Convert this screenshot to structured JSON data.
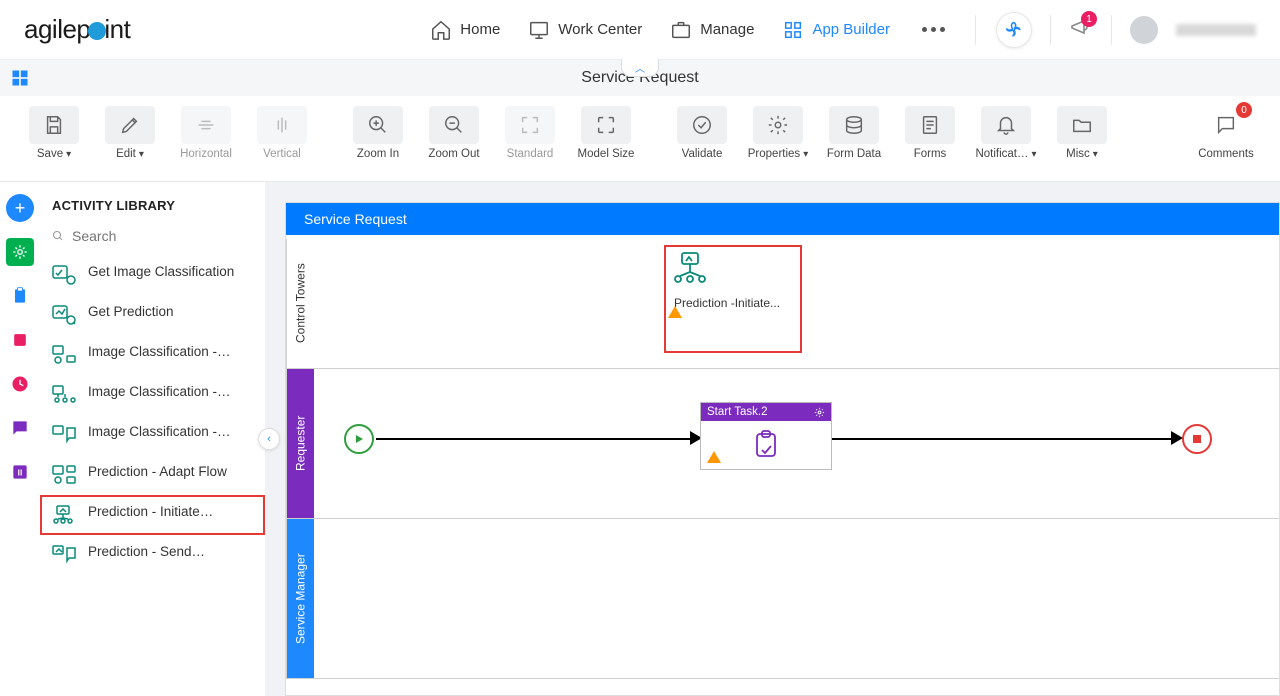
{
  "brand": {
    "name_a": "agilep",
    "name_b": "int"
  },
  "nav": {
    "home": "Home",
    "work_center": "Work Center",
    "manage": "Manage",
    "app_builder": "App Builder"
  },
  "notifications_badge": "1",
  "page_title": "Service Request",
  "toolbar": {
    "save": "Save",
    "edit": "Edit",
    "horizontal": "Horizontal",
    "vertical": "Vertical",
    "zoom_in": "Zoom In",
    "zoom_out": "Zoom Out",
    "standard": "Standard",
    "model_size": "Model Size",
    "validate": "Validate",
    "properties": "Properties",
    "form_data": "Form Data",
    "forms": "Forms",
    "notifications": "Notificat…",
    "misc": "Misc",
    "comments": "Comments",
    "comments_count": "0"
  },
  "sidebar": {
    "title": "ACTIVITY LIBRARY",
    "search_placeholder": "Search",
    "items": [
      {
        "label": "Get Image Classification"
      },
      {
        "label": "Get Prediction"
      },
      {
        "label": "Image Classification -…"
      },
      {
        "label": "Image Classification -…"
      },
      {
        "label": "Image Classification -…"
      },
      {
        "label": "Prediction - Adapt Flow"
      },
      {
        "label": "Prediction - Initiate…"
      },
      {
        "label": "Prediction - Send…"
      }
    ]
  },
  "canvas": {
    "header": "Service Request",
    "lanes": {
      "control_towers": "Control Towers",
      "requester": "Requester",
      "service_manager": "Service Manager"
    },
    "node_prediction_label": "Prediction -Initiate...",
    "task_title": "Start Task.2"
  }
}
